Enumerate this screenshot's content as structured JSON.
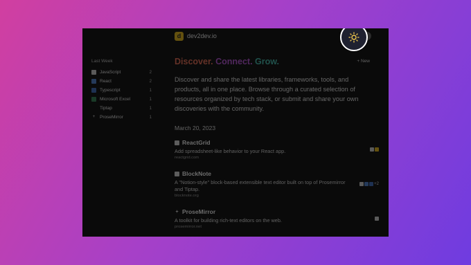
{
  "header": {
    "logo_glyph": "d",
    "site_name": "dev2dev.io"
  },
  "theme_toggle": {
    "icon": "sun-icon"
  },
  "sidebar": {
    "heading": "Last Week",
    "items": [
      {
        "label": "JavaScript",
        "count": "2",
        "icon_glyph": "JS",
        "color": "#c9c9c9"
      },
      {
        "label": "React",
        "count": "2",
        "icon_glyph": "",
        "color": "#4a7cc9"
      },
      {
        "label": "Typescript",
        "count": "1",
        "icon_glyph": "",
        "color": "#3a68b5"
      },
      {
        "label": "Microsoft Excel",
        "count": "1",
        "icon_glyph": "",
        "color": "#2f7d4f"
      },
      {
        "label": "Tiptap",
        "count": "1",
        "icon_glyph": "",
        "color": ""
      },
      {
        "label": "ProseMirror",
        "count": "1",
        "icon_glyph": "+",
        "color": ""
      }
    ]
  },
  "main": {
    "hero": {
      "word1": "Discover.",
      "word1_color": "#e0684f",
      "word2": "Connect.",
      "word2_color": "#b04fd0",
      "word3": "Grow.",
      "word3_color": "#3fb3a6"
    },
    "new_link": "+ New",
    "intro": "Discover and share the latest libraries, frameworks, tools, and products, all in one place. Browse through a curated selection of resources organized by tech stack, or submit and share your own discoveries with the community.",
    "date": "March 20, 2023",
    "entries": [
      {
        "title": "ReactGrid",
        "description": "Add spreadsheet-like behavior to your React app.",
        "url": "reactgrid.com",
        "tags": []
      },
      {
        "title": "BlockNote",
        "description": "A \"Notion-style\" block-based extensible text editor built on top of Prosemirror and Tiptap.",
        "url": "blocknote.org",
        "tags": [
          "+2"
        ]
      },
      {
        "title": "ProseMirror",
        "description": "A toolkit for building rich-text editors on the web.",
        "url": "prosemirror.net",
        "tags": []
      }
    ]
  }
}
